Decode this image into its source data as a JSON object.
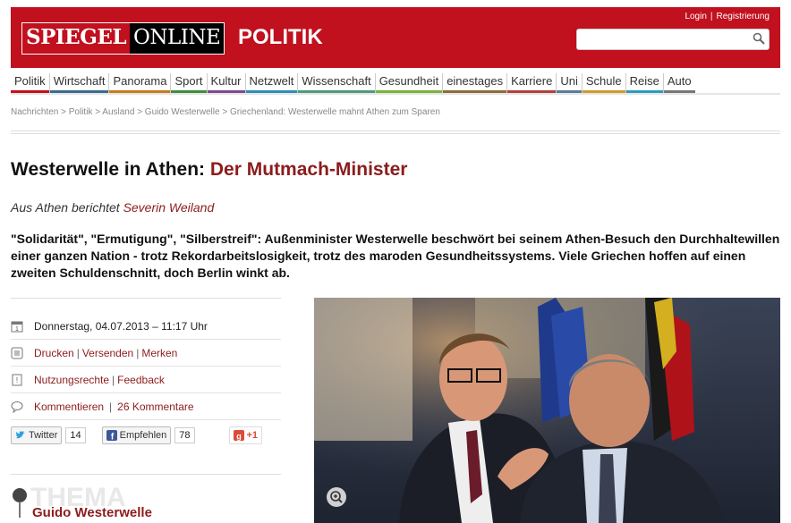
{
  "header": {
    "logo_part1": "SPIEGEL",
    "logo_part2": "ONLINE",
    "section": "POLITIK",
    "login": "Login",
    "separator": "|",
    "register": "Registrierung",
    "search_placeholder": "",
    "brand_color": "#c1101e"
  },
  "nav": {
    "items": [
      {
        "label": "Politik",
        "color": "#c1101e"
      },
      {
        "label": "Wirtschaft",
        "color": "#3a6b8c"
      },
      {
        "label": "Panorama",
        "color": "#c87b1c"
      },
      {
        "label": "Sport",
        "color": "#3f8d3f"
      },
      {
        "label": "Kultur",
        "color": "#7a4a92"
      },
      {
        "label": "Netzwelt",
        "color": "#2c8fb8"
      },
      {
        "label": "Wissenschaft",
        "color": "#4d9b7b"
      },
      {
        "label": "Gesundheit",
        "color": "#7bb33a"
      },
      {
        "label": "einestages",
        "color": "#8a6d3b"
      },
      {
        "label": "Karriere",
        "color": "#b3413a"
      },
      {
        "label": "Uni",
        "color": "#5a7d9a"
      },
      {
        "label": "Schule",
        "color": "#d19a26"
      },
      {
        "label": "Reise",
        "color": "#2a9bbf"
      },
      {
        "label": "Auto",
        "color": "#777777"
      }
    ]
  },
  "breadcrumb": "Nachrichten > Politik > Ausland > Guido Westerwelle > Griechenland: Westerwelle mahnt Athen zum Sparen",
  "article": {
    "title_main": "Westerwelle in Athen: ",
    "title_sub": "Der Mutmach-Minister",
    "byline_prefix": "Aus Athen berichtet ",
    "author": "Severin Weiland",
    "lead": "\"Solidarität\", \"Ermutigung\", \"Silberstreif\": Außenminister Westerwelle beschwört bei seinem Athen-Besuch den Durchhaltewillen einer ganzen Nation - trotz Rekordarbeitslosigkeit, trotz des maroden Gesundheitssystems. Viele Griechen hoffen auf einen zweiten Schuldenschnitt, doch Berlin winkt ab."
  },
  "meta": {
    "date": "Donnerstag, 04.07.2013 – 11:17 Uhr",
    "print": "Drucken",
    "send": "Versenden",
    "bookmark": "Merken",
    "rights": "Nutzungsrechte",
    "feedback": "Feedback",
    "comment": "Kommentieren",
    "comments_count": "26 Kommentare",
    "twitter": "Twitter",
    "twitter_count": "14",
    "facebook": "Empfehlen",
    "facebook_count": "78",
    "gplus": "+1"
  },
  "thema": {
    "label": "THEMA",
    "link": "Guido Westerwelle"
  }
}
